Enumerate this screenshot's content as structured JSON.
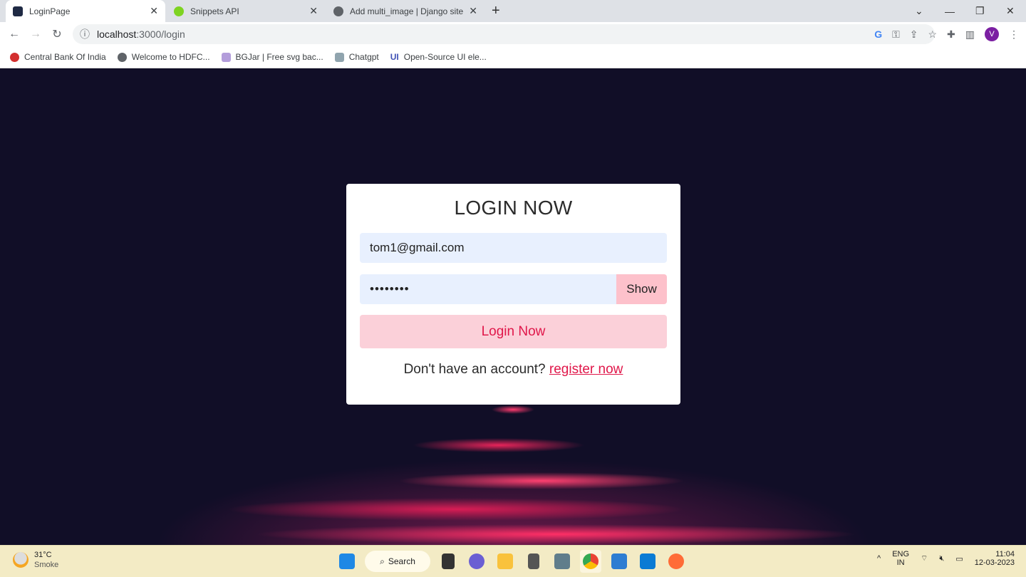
{
  "browser": {
    "tabs": [
      {
        "label": "LoginPage",
        "active": true,
        "icon": "react-icon",
        "color": "#1f2a44"
      },
      {
        "label": "Snippets API",
        "active": false,
        "icon": "api-icon",
        "color": "#7ed321"
      },
      {
        "label": "Add multi_image | Django site ad",
        "active": false,
        "icon": "globe-icon",
        "color": "#5f6368"
      }
    ],
    "new_tab": "+",
    "url_host": "localhost",
    "url_path": ":3000/login",
    "profile_initial": "V",
    "bookmarks": [
      {
        "label": "Central Bank Of India",
        "color": "#d32f2f"
      },
      {
        "label": "Welcome to HDFC...",
        "color": "#5f6368"
      },
      {
        "label": "BGJar | Free svg bac...",
        "color": "#b39ddb"
      },
      {
        "label": "Chatgpt",
        "color": "#90a4ae"
      },
      {
        "label": "Open-Source UI ele...",
        "color": "#3f51b5"
      }
    ]
  },
  "login": {
    "title": "LOGIN NOW",
    "email_value": "tom1@gmail.com",
    "password_value": "••••••••",
    "show_label": "Show",
    "submit_label": "Login Now",
    "footer_text": "Don't have an account? ",
    "register_link": "register now",
    "accent": "#e0174a"
  },
  "taskbar": {
    "temp": "31°C",
    "weather": "Smoke",
    "search_label": "Search",
    "lang": "ENG",
    "region": "IN",
    "time": "11:04",
    "date": "12-03-2023"
  }
}
